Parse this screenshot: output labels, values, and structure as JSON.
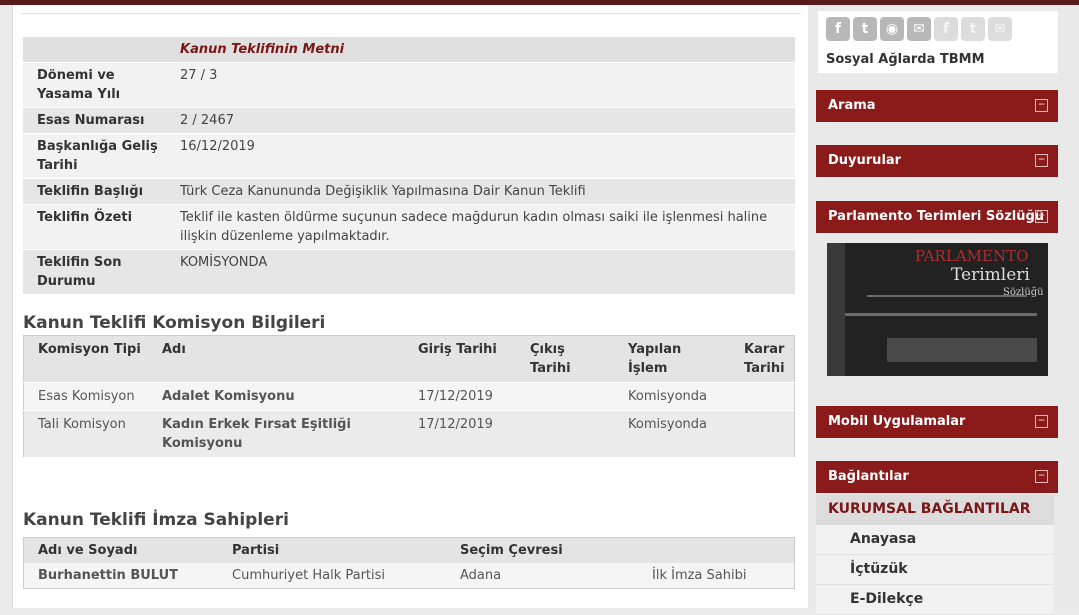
{
  "info": {
    "header_title": "Kanun Teklifinin Metni",
    "rows": [
      {
        "label": "Dönemi ve Yasama Yılı",
        "value": "27 / 3"
      },
      {
        "label": "Esas Numarası",
        "value": "2 / 2467"
      },
      {
        "label": "Başkanlığa Geliş Tarihi",
        "value": "16/12/2019"
      },
      {
        "label": "Teklifin Başlığı",
        "value": "Türk Ceza Kanununda Değişiklik Yapılmasına Dair Kanun Teklifi"
      },
      {
        "label": "Teklifin Özeti",
        "value": "Teklif ile kasten öldürme suçunun sadece mağdurun kadın olması saiki ile işlenmesi haline ilişkin düzenleme yapılmaktadır."
      },
      {
        "label": "Teklifin Son Durumu",
        "value": "KOMİSYONDA"
      }
    ]
  },
  "komisyon": {
    "title": "Kanun Teklifi Komisyon Bilgileri",
    "headers": [
      "Komisyon Tipi",
      "Adı",
      "Giriş Tarihi",
      "Çıkış Tarihi",
      "Yapılan İşlem",
      "Karar Tarihi"
    ],
    "rows": [
      {
        "tip": "Esas Komisyon",
        "adi": "Adalet Komisyonu",
        "giris": "17/12/2019",
        "cikis": "",
        "islem": "Komisyonda",
        "karar": ""
      },
      {
        "tip": "Tali Komisyon",
        "adi": "Kadın Erkek Fırsat Eşitliği Komisyonu",
        "giris": "17/12/2019",
        "cikis": "",
        "islem": "Komisyonda",
        "karar": ""
      }
    ]
  },
  "imza": {
    "title": "Kanun Teklifi İmza Sahipleri",
    "headers": [
      "Adı ve Soyadı",
      "Partisi",
      "Seçim Çevresi",
      ""
    ],
    "rows": [
      {
        "ad": "Burhanettin BULUT",
        "parti": "Cumhuriyet Halk Partisi",
        "cevre": "Adana",
        "rol": "İlk İmza Sahibi"
      }
    ]
  },
  "sidebar": {
    "social_label": "Sosyal Ağlarda TBMM",
    "social_icons": [
      "facebook-icon",
      "twitter-icon",
      "rss-icon",
      "email-icon",
      "facebook-small-icon",
      "twitter-small-icon",
      "mail-small-icon"
    ],
    "social_glyphs": [
      "f",
      "t",
      "◉",
      "✉",
      "f",
      "t",
      "✉"
    ],
    "panels": [
      "Arama",
      "Duyurular",
      "Parlamento Terimleri Sözlüğü",
      "Mobil Uygulamalar",
      "Bağlantılar"
    ],
    "expand_glyph": "−",
    "sozluk_banner": {
      "line1": "PARLAMENTO",
      "line2": "Terimleri",
      "line3": "Sözlüğü"
    },
    "kurumsal_label": "KURUMSAL BAĞLANTILAR",
    "links": [
      "Anayasa",
      "İçtüzük",
      "E-Dilekçe"
    ]
  },
  "colors": {
    "accent": "#8b1a1a",
    "link_red": "#7a1616"
  }
}
